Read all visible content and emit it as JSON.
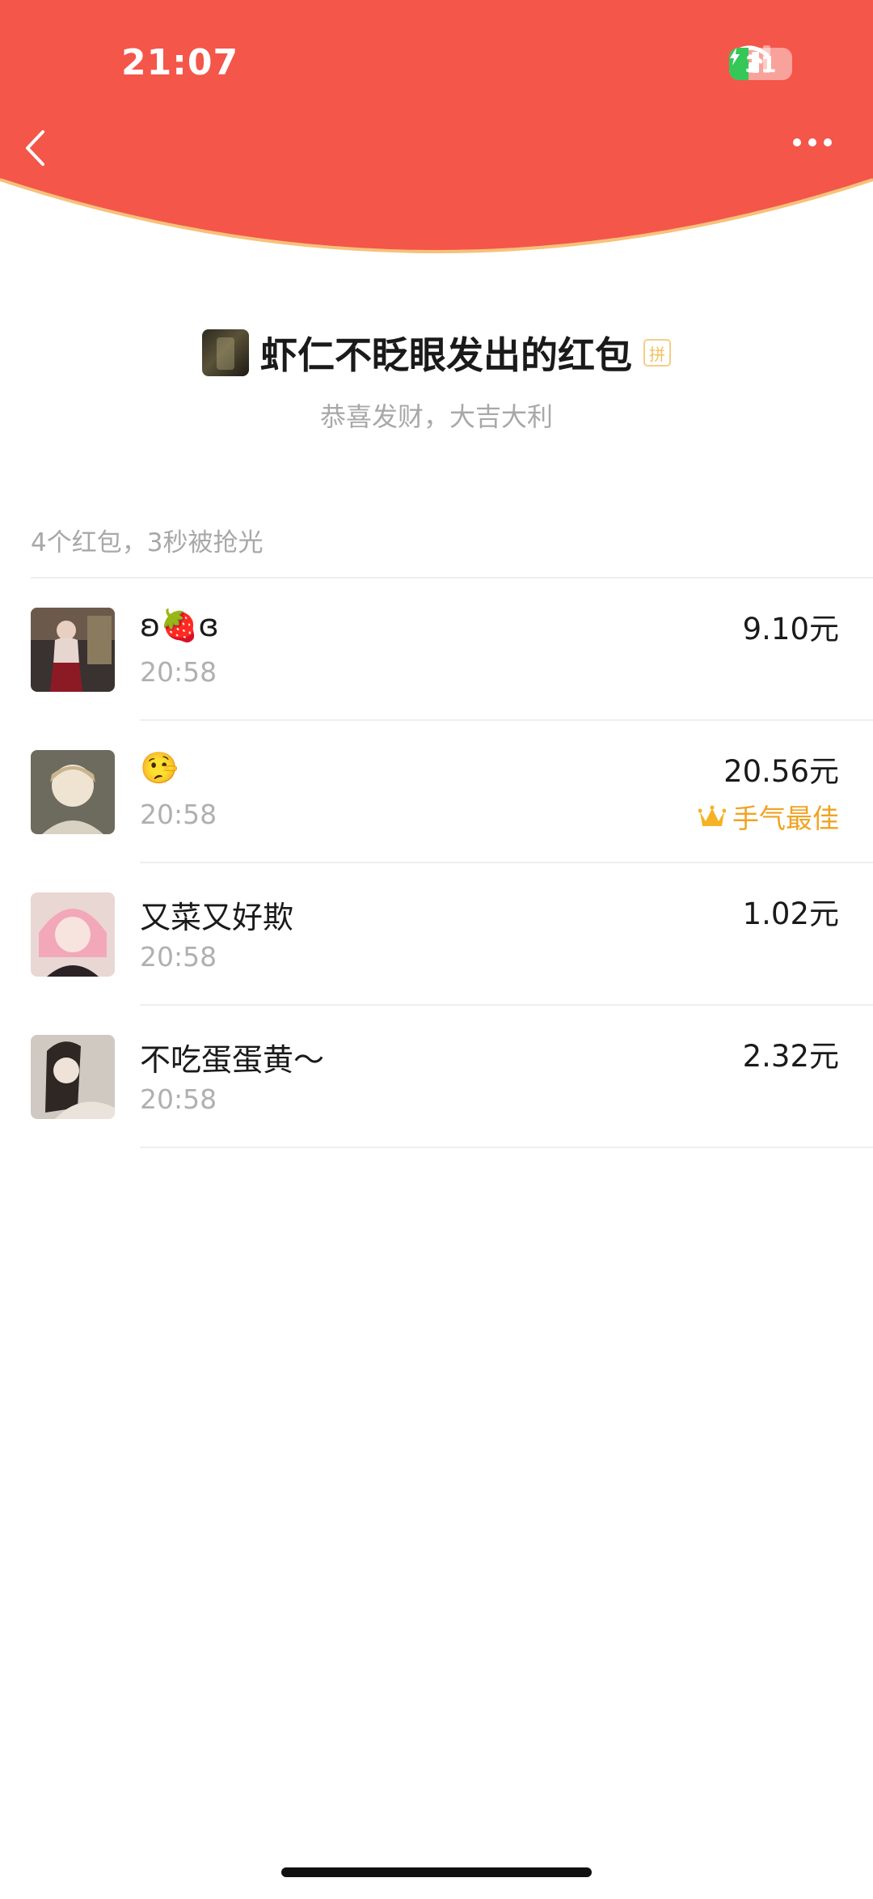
{
  "status_bar": {
    "time": "21:07",
    "battery": "31",
    "battery_level_percent": 31,
    "icons": [
      "signal-icon",
      "wifi-icon",
      "battery-charging-icon"
    ]
  },
  "nav": {
    "icons": [
      "chevron-left-icon",
      "more-icon"
    ]
  },
  "sender": {
    "title": "虾仁不眨眼发出的红包",
    "badge": "拼",
    "greeting": "恭喜发财，大吉大利"
  },
  "summary": "4个红包，3秒被抢光",
  "records": [
    {
      "name": "ʚ🍓ɞ",
      "time": "20:58",
      "amount": "9.10元",
      "best": ""
    },
    {
      "name": "🤥",
      "time": "20:58",
      "amount": "20.56元",
      "best": "手气最佳"
    },
    {
      "name": "又菜又好欺",
      "time": "20:58",
      "amount": "1.02元",
      "best": ""
    },
    {
      "name": "不吃蛋蛋黄～",
      "time": "20:58",
      "amount": "2.32元",
      "best": ""
    }
  ],
  "colors": {
    "header_red": "#f4564a",
    "header_rim": "#f7c17a",
    "best_luck_gold": "#f1a322",
    "muted_text": "#a8a8a8"
  }
}
